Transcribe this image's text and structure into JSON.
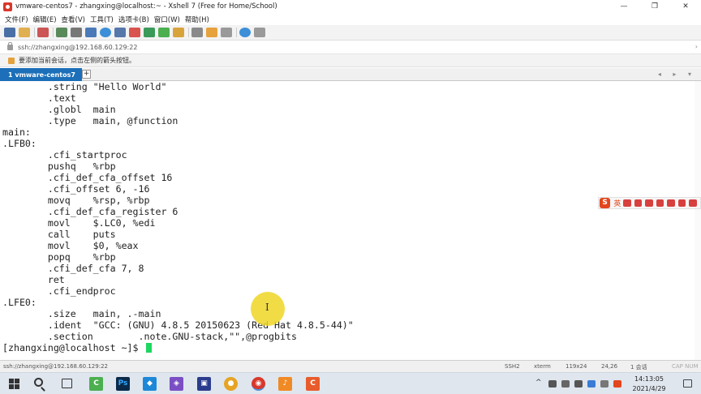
{
  "window": {
    "title": "vmware-centos7 - zhangxing@localhost:~ - Xshell 7 (Free for Home/School)",
    "minimize": "—",
    "maximize": "❐",
    "close": "✕"
  },
  "menu": [
    "文件(F)",
    "编辑(E)",
    "查看(V)",
    "工具(T)",
    "选项卡(B)",
    "窗口(W)",
    "帮助(H)"
  ],
  "toolbar": {
    "icons": [
      "new-session-icon",
      "open-folder-icon",
      "reconnect-icon",
      "new-window-icon",
      "find-icon",
      "properties-icon",
      "globe-icon",
      "font-icon",
      "xftp-icon",
      "xagent-icon",
      "fullscreen-icon",
      "lock-icon",
      "keyboard-icon",
      "folder-icon",
      "layout-icon",
      "help-icon",
      "chat-icon"
    ]
  },
  "address": {
    "url": "ssh://zhangxing@192.168.60.129:22",
    "arrow": "›"
  },
  "hint": {
    "text": "要添加当前会话，点击左侧的箭头按钮。"
  },
  "tabs": [
    {
      "label": "1 vmware-centos7"
    }
  ],
  "tab_add": "+",
  "tab_nav": "◂ ▸ ▾",
  "terminal": {
    "lines": [
      "        .string \"Hello World\"",
      "        .text",
      "        .globl  main",
      "        .type   main, @function",
      "main:",
      ".LFB0:",
      "        .cfi_startproc",
      "        pushq   %rbp",
      "        .cfi_def_cfa_offset 16",
      "        .cfi_offset 6, -16",
      "        movq    %rsp, %rbp",
      "        .cfi_def_cfa_register 6",
      "        movl    $.LC0, %edi",
      "        call    puts",
      "        movl    $0, %eax",
      "        popq    %rbp",
      "        .cfi_def_cfa 7, 8",
      "        ret",
      "        .cfi_endproc",
      ".LFE0:",
      "        .size   main, .-main",
      "        .ident  \"GCC: (GNU) 4.8.5 20150623 (Red Hat 4.8.5-44)\"",
      "        .section        .note.GNU-stack,\"\",@progbits"
    ],
    "prompt": "[zhangxing@localhost ~]$ ",
    "cursor_glyph": "I"
  },
  "ime": {
    "logo": "S",
    "mode": "英"
  },
  "status": {
    "host": "ssh://zhangxing@192.168.60.129:22",
    "protocol": "SSH2",
    "term": "xterm",
    "size": "119x24",
    "pos": "24,26",
    "sessions": "1 会话",
    "caps": "CAP NUM"
  },
  "taskbar": {
    "apps": [
      {
        "name": "taskbar-app-qq-browser",
        "glyph": "C",
        "color": "#4caf50"
      },
      {
        "name": "taskbar-app-photoshop",
        "glyph": "Ps",
        "color": "#0b2a4a"
      },
      {
        "name": "taskbar-app-vscode",
        "glyph": "◆",
        "color": "#1e88d8"
      },
      {
        "name": "taskbar-app-visual-studio",
        "glyph": "◈",
        "color": "#7b4fc4"
      },
      {
        "name": "taskbar-app-editor",
        "glyph": "▣",
        "color": "#2a3c8c"
      },
      {
        "name": "taskbar-app-chrome",
        "glyph": "●",
        "color": "#e7a423"
      },
      {
        "name": "taskbar-app-xshell",
        "glyph": "◉",
        "color": "#d9382c"
      },
      {
        "name": "taskbar-app-recorder",
        "glyph": "♪",
        "color": "#f08a24"
      },
      {
        "name": "taskbar-app-capture",
        "glyph": "C",
        "color": "#e85c2c"
      }
    ],
    "tray_chevron": "^",
    "time": "14:13:05",
    "date": "2021/4/29"
  },
  "colors": {
    "tab_active": "#1c6fb8",
    "cursor": "#1ed760",
    "highlight": "#eed625"
  }
}
